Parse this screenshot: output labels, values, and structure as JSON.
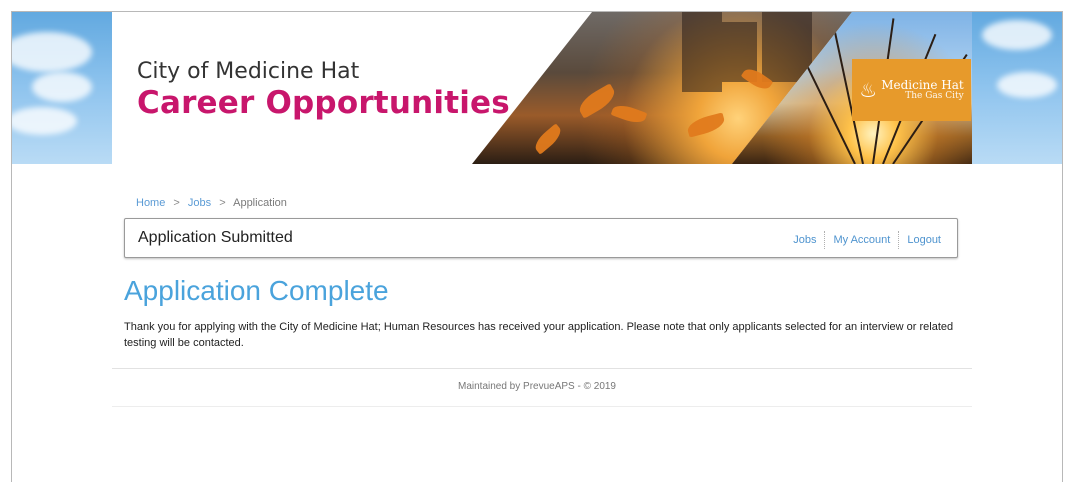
{
  "banner": {
    "subtitle": "City of Medicine Hat",
    "title": "Career Opportunities",
    "logo": {
      "icon": "flame-icon",
      "name": "Medicine Hat",
      "tagline": "The Gas City",
      "color": "#e79a2b"
    }
  },
  "breadcrumb": {
    "items": [
      "Home",
      "Jobs",
      "Application"
    ],
    "separator": ">"
  },
  "header": {
    "title": "Application Submitted",
    "nav": [
      "Jobs",
      "My Account",
      "Logout"
    ]
  },
  "main": {
    "heading": "Application Complete",
    "message": "Thank you for applying with the City of Medicine Hat; Human Resources has received your application. Please note that only applicants selected for an interview or related testing will be contacted."
  },
  "footer": {
    "text": "Maintained by PrevueAPS - © 2019"
  },
  "colors": {
    "title_accent": "#c8166c",
    "heading_blue": "#4aa3dc",
    "link_blue": "#5b9bd5"
  }
}
